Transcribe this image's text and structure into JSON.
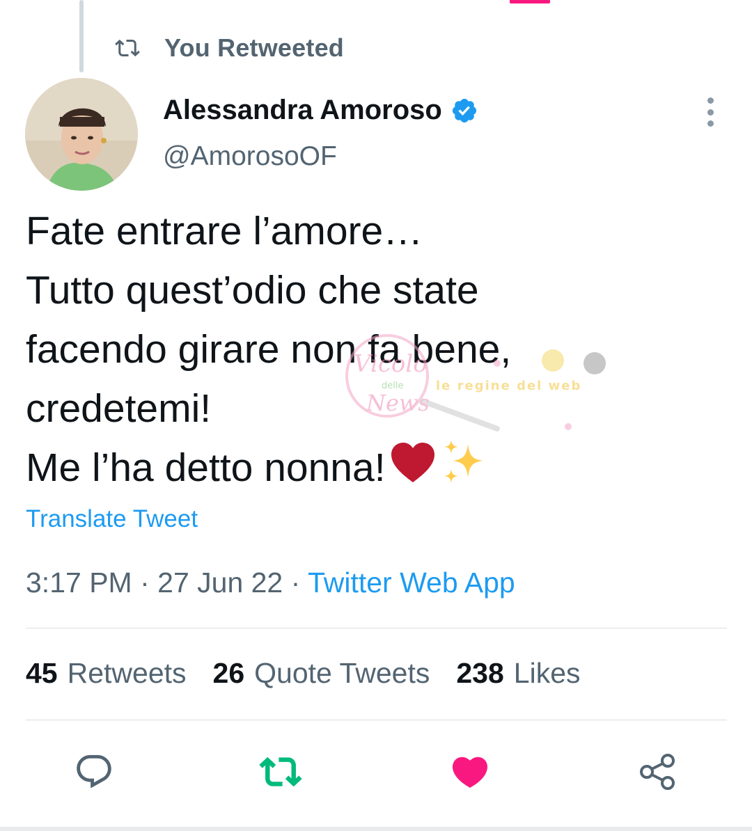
{
  "context": {
    "retweet_label": "You Retweeted"
  },
  "author": {
    "name": "Alessandra Amoroso",
    "handle": "@AmorosoOF",
    "verified": true
  },
  "tweet": {
    "lines": [
      "Fate entrare l’amore…",
      "Tutto quest’odio che state",
      "facendo girare non fa bene,",
      "credetemi!",
      "Me l’ha detto nonna!"
    ],
    "emojis": [
      "heart-emoji",
      "sparkles-emoji"
    ],
    "translate_label": "Translate Tweet",
    "time": "3:17 PM",
    "separator": " · ",
    "date": "27 Jun 22",
    "source": "Twitter Web App"
  },
  "stats": [
    {
      "count": "45",
      "label": "Retweets"
    },
    {
      "count": "26",
      "label": "Quote Tweets"
    },
    {
      "count": "238",
      "label": "Likes"
    }
  ],
  "actions": {
    "reply_icon": "reply-icon",
    "retweet_icon": "retweet-icon",
    "like_icon": "like-icon",
    "share_icon": "share-icon",
    "retweet_active_color": "#00ba7c",
    "like_active_color": "#f91880"
  },
  "colors": {
    "accent": "#1d9bf0",
    "secondary_text": "#536471",
    "primary_text": "#0f1419"
  },
  "watermark": {
    "text_a": "Vicolo",
    "text_b": "delle",
    "text_c": "News",
    "text_d": "le regine del web"
  }
}
